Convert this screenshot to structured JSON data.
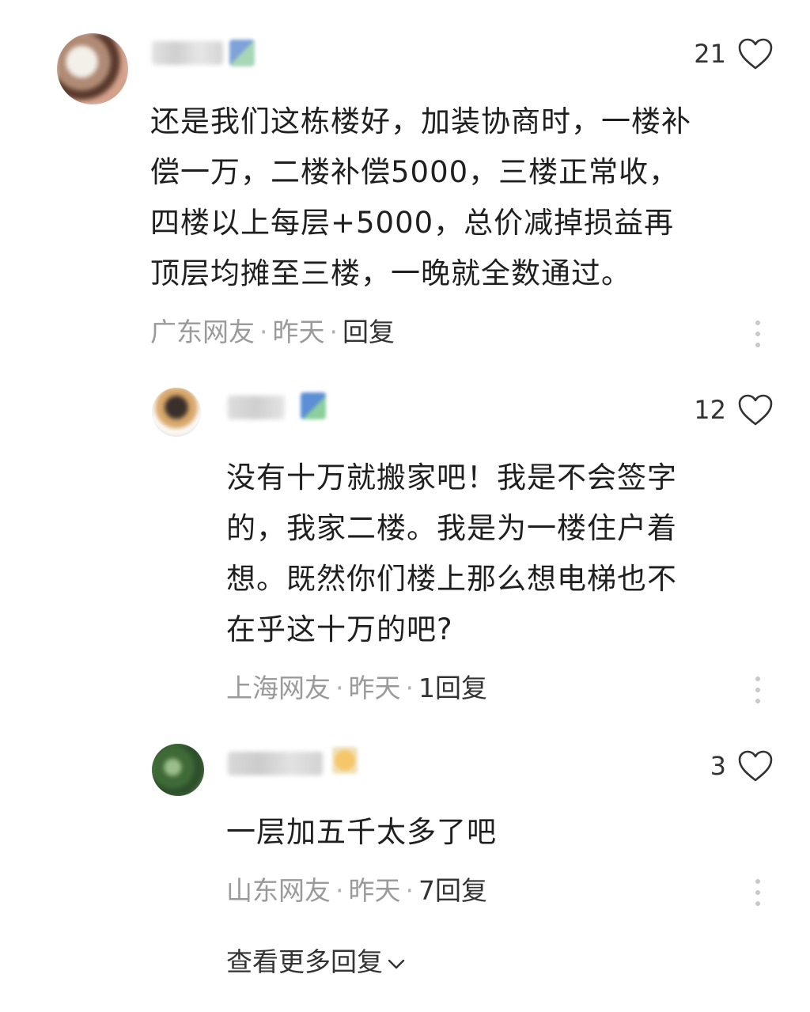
{
  "comments": [
    {
      "likes": "21",
      "text_lines": [
        "还是我们这栋楼好，加装协商时，一楼补",
        "偿一万，二楼补偿5000，三楼正常收，",
        "四楼以上每层+5000，总价减掉损益再",
        "顶层均摊至三楼，一晚就全数通过。"
      ],
      "location": "广东网友",
      "time": "昨天",
      "reply": "回复",
      "separator": "·"
    },
    {
      "likes": "12",
      "text_lines": [
        "没有十万就搬家吧！我是不会签字",
        "的，我家二楼。我是为一楼住户着",
        "想。既然你们楼上那么想电梯也不",
        "在乎这十万的吧?"
      ],
      "location": "上海网友",
      "time": "昨天",
      "reply": "1回复",
      "separator": "·"
    },
    {
      "likes": "3",
      "text_lines": [
        "一层加五千太多了吧"
      ],
      "location": "山东网友",
      "time": "昨天",
      "reply": "7回复",
      "separator": "·"
    }
  ],
  "view_more": "查看更多回复",
  "icons": {
    "like": "heart-outline-icon",
    "more": "more-vertical-icon",
    "expand": "chevron-down-icon"
  },
  "colors": {
    "text": "#1f1f1f",
    "meta": "#9a9a9a",
    "reply": "#333333"
  }
}
